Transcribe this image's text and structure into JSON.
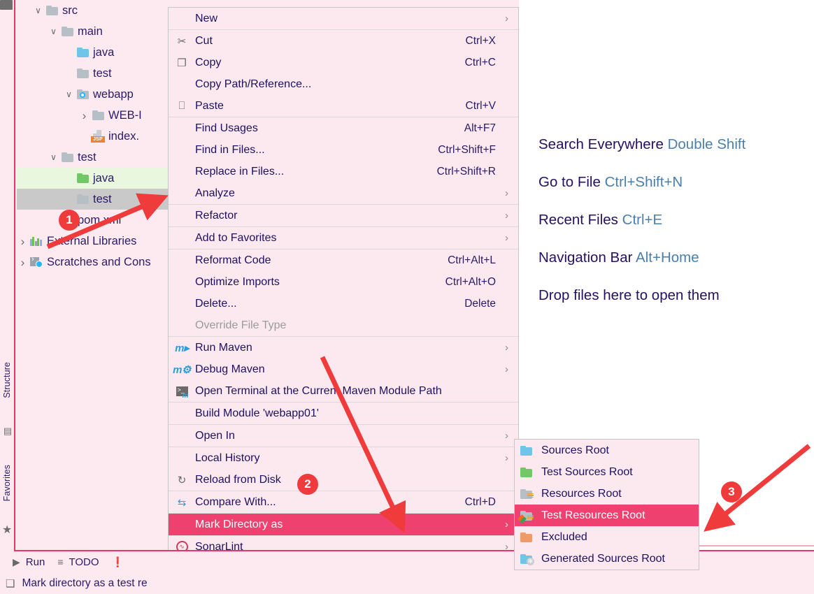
{
  "tree": {
    "items": [
      {
        "indent": 2,
        "twisty": "v",
        "icon": "folder-grey",
        "label": "src",
        "state": "none"
      },
      {
        "indent": 3,
        "twisty": "v",
        "icon": "folder-grey",
        "label": "main",
        "state": "none"
      },
      {
        "indent": 4,
        "twisty": "",
        "icon": "folder-blue",
        "label": "java",
        "state": "none"
      },
      {
        "indent": 4,
        "twisty": "",
        "icon": "folder-grey",
        "label": "test",
        "state": "none"
      },
      {
        "indent": 4,
        "twisty": "v",
        "icon": "webapp-icon",
        "label": "webapp",
        "state": "none"
      },
      {
        "indent": 5,
        "twisty": ">",
        "icon": "folder-grey",
        "label": "WEB-I",
        "state": "none"
      },
      {
        "indent": 5,
        "twisty": "",
        "icon": "jsp-file-icon",
        "label": "index.",
        "state": "none"
      },
      {
        "indent": 3,
        "twisty": "v",
        "icon": "folder-grey",
        "label": "test",
        "state": "none"
      },
      {
        "indent": 4,
        "twisty": "",
        "icon": "folder-green",
        "label": "java",
        "state": "green"
      },
      {
        "indent": 4,
        "twisty": "",
        "icon": "folder-grey",
        "label": "test",
        "state": "grey"
      },
      {
        "indent": 3,
        "twisty": "",
        "icon": "xml-file-icon",
        "label": "pom.xml",
        "state": "none"
      },
      {
        "indent": 1,
        "twisty": ">",
        "icon": "libraries-icon",
        "label": "External Libraries",
        "state": "none"
      },
      {
        "indent": 1,
        "twisty": ">",
        "icon": "scratches-icon",
        "label": "Scratches and Cons",
        "state": "none"
      }
    ]
  },
  "left_strip": {
    "structure_label": "Structure",
    "favorites_label": "Favorites"
  },
  "context_menu": {
    "groups": [
      [
        {
          "icon": "",
          "label": "New",
          "shortcut": "",
          "arrow": true,
          "mnemonic": ""
        }
      ],
      [
        {
          "icon": "scissors-icon",
          "label": "Cut",
          "shortcut": "Ctrl+X",
          "arrow": false,
          "mnemonic": "t"
        },
        {
          "icon": "copy-icon",
          "label": "Copy",
          "shortcut": "Ctrl+C",
          "arrow": false,
          "mnemonic": "C"
        },
        {
          "icon": "",
          "label": "Copy Path/Reference...",
          "shortcut": "",
          "arrow": false,
          "mnemonic": ""
        },
        {
          "icon": "clipboard-icon",
          "label": "Paste",
          "shortcut": "Ctrl+V",
          "arrow": false,
          "mnemonic": "P"
        }
      ],
      [
        {
          "icon": "",
          "label": "Find Usages",
          "shortcut": "Alt+F7",
          "arrow": false,
          "mnemonic": "U"
        },
        {
          "icon": "",
          "label": "Find in Files...",
          "shortcut": "Ctrl+Shift+F",
          "arrow": false,
          "mnemonic": ""
        },
        {
          "icon": "",
          "label": "Replace in Files...",
          "shortcut": "Ctrl+Shift+R",
          "arrow": false,
          "mnemonic": "a"
        },
        {
          "icon": "",
          "label": "Analyze",
          "shortcut": "",
          "arrow": true,
          "mnemonic": "z"
        }
      ],
      [
        {
          "icon": "",
          "label": "Refactor",
          "shortcut": "",
          "arrow": true,
          "mnemonic": "R"
        }
      ],
      [
        {
          "icon": "",
          "label": "Add to Favorites",
          "shortcut": "",
          "arrow": true,
          "mnemonic": "a"
        }
      ],
      [
        {
          "icon": "",
          "label": "Reformat Code",
          "shortcut": "Ctrl+Alt+L",
          "arrow": false,
          "mnemonic": "R"
        },
        {
          "icon": "",
          "label": "Optimize Imports",
          "shortcut": "Ctrl+Alt+O",
          "arrow": false,
          "mnemonic": "z"
        },
        {
          "icon": "",
          "label": "Delete...",
          "shortcut": "Delete",
          "arrow": false,
          "mnemonic": "D"
        },
        {
          "icon": "",
          "label": "Override File Type",
          "shortcut": "",
          "arrow": false,
          "mnemonic": "",
          "disabled": true
        }
      ],
      [
        {
          "icon": "maven-run-icon",
          "label": "Run Maven",
          "shortcut": "",
          "arrow": true,
          "mnemonic": ""
        },
        {
          "icon": "maven-debug-icon",
          "label": "Debug Maven",
          "shortcut": "",
          "arrow": true,
          "mnemonic": ""
        },
        {
          "icon": "terminal-maven-icon",
          "label": "Open Terminal at the Current Maven Module Path",
          "shortcut": "",
          "arrow": false,
          "mnemonic": ""
        }
      ],
      [
        {
          "icon": "",
          "label": "Build Module 'webapp01'",
          "shortcut": "",
          "arrow": false,
          "mnemonic": "M"
        }
      ],
      [
        {
          "icon": "",
          "label": "Open In",
          "shortcut": "",
          "arrow": true,
          "mnemonic": ""
        }
      ],
      [
        {
          "icon": "",
          "label": "Local History",
          "shortcut": "",
          "arrow": true,
          "mnemonic": "H"
        },
        {
          "icon": "reload-icon",
          "label": "Reload from Disk",
          "shortcut": "",
          "arrow": false,
          "mnemonic": ""
        }
      ],
      [
        {
          "icon": "compare-icon",
          "label": "Compare With...",
          "shortcut": "Ctrl+D",
          "arrow": false,
          "mnemonic": ""
        }
      ],
      [
        {
          "icon": "",
          "label": "Mark Directory as",
          "shortcut": "",
          "arrow": true,
          "mnemonic": "",
          "highlighted": true
        }
      ],
      [
        {
          "icon": "sonarlint-icon",
          "label": "SonarLint",
          "shortcut": "",
          "arrow": true,
          "mnemonic": ""
        }
      ]
    ]
  },
  "submenu": {
    "items": [
      {
        "icon": "folder-blue",
        "label": "Sources Root",
        "highlighted": false
      },
      {
        "icon": "folder-green",
        "label": "Test Sources Root",
        "highlighted": false
      },
      {
        "icon": "folder-resources",
        "label": "Resources Root",
        "highlighted": false
      },
      {
        "icon": "folder-test-res",
        "label": "Test Resources Root",
        "highlighted": true
      },
      {
        "icon": "folder-orange",
        "label": "Excluded",
        "highlighted": false
      },
      {
        "icon": "folder-generated",
        "label": "Generated Sources Root",
        "highlighted": false
      }
    ]
  },
  "editor_hints": [
    {
      "action": "Search Everywhere",
      "key": "Double Shift"
    },
    {
      "action": "Go to File",
      "key": "Ctrl+Shift+N"
    },
    {
      "action": "Recent Files",
      "key": "Ctrl+E"
    },
    {
      "action": "Navigation Bar",
      "key": "Alt+Home"
    },
    {
      "action": "Drop files here to open them",
      "key": ""
    }
  ],
  "toolwindow_bar": [
    {
      "icon": "run-icon",
      "label": "Run"
    },
    {
      "icon": "todo-icon",
      "label": "TODO"
    },
    {
      "icon": "problems-icon",
      "label": ""
    }
  ],
  "status_bar": {
    "icon": "terminal-status-icon",
    "text": "Mark directory as a test re"
  },
  "annotations": [
    {
      "number": "1"
    },
    {
      "number": "2"
    },
    {
      "number": "3"
    }
  ],
  "colors": {
    "accent": "#ee416f",
    "menu_bg": "#fbe9ef",
    "ide_bg": "#fdeaf0",
    "text": "#1f1060",
    "hint_key": "#4a7fad",
    "annotation_red": "#ef3b3b",
    "selection_green": "#e8f7dd",
    "selection_grey": "#c9c9c9"
  }
}
